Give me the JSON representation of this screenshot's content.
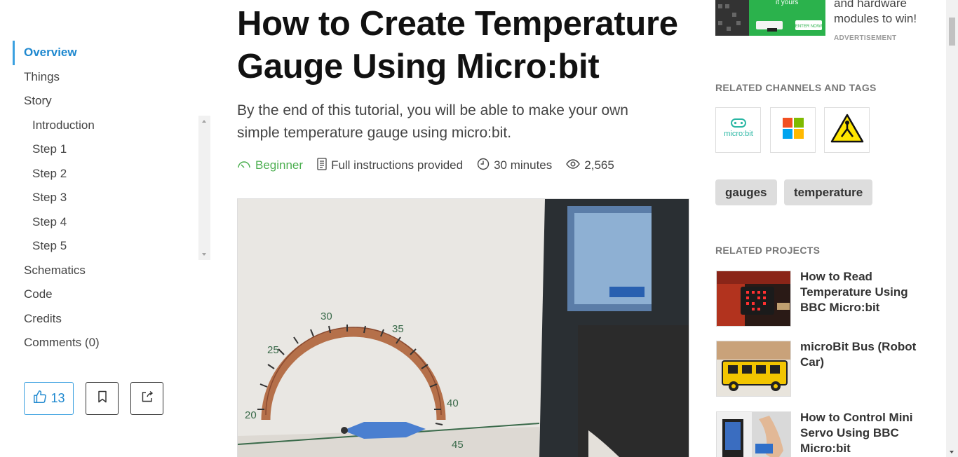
{
  "toc": {
    "items": [
      {
        "label": "Overview"
      },
      {
        "label": "Things"
      },
      {
        "label": "Story"
      }
    ],
    "sub_items": [
      {
        "label": "Introduction"
      },
      {
        "label": "Step 1"
      },
      {
        "label": "Step 2"
      },
      {
        "label": "Step 3"
      },
      {
        "label": "Step 4"
      },
      {
        "label": "Step 5"
      }
    ],
    "after_items": [
      {
        "label": "Schematics"
      },
      {
        "label": "Code"
      },
      {
        "label": "Credits"
      },
      {
        "label": "Comments (0)"
      }
    ]
  },
  "actions": {
    "like_count": "13",
    "like_icon": "thumbs-up-icon",
    "bookmark_icon": "bookmark-icon",
    "share_icon": "share-icon"
  },
  "project": {
    "title_line1": "How to Create Temperature",
    "title_line2": "Gauge Using Micro:bit",
    "subtitle_line1": "By the end of this tutorial, you will be able to make your own",
    "subtitle_line2": "simple temperature gauge using micro:bit.",
    "difficulty": "Beginner",
    "instructions": "Full instructions provided",
    "duration": "30 minutes",
    "views": "2,565"
  },
  "video": {
    "gauge_labels": [
      "20",
      "25",
      "30",
      "35",
      "40",
      "45"
    ]
  },
  "ad": {
    "text_line1": "and hardware",
    "text_line2": "modules to win!",
    "label": "ADVERTISEMENT",
    "banner_text": "it yours",
    "banner_button": "ENTER NOW!"
  },
  "related_channels": {
    "heading": "RELATED CHANNELS AND TAGS",
    "channels": [
      {
        "name": "micro:bit",
        "icon": "microbit-logo-icon"
      },
      {
        "name": "Microsoft",
        "icon": "microsoft-logo-icon"
      },
      {
        "name": "Warning",
        "icon": "warning-triangle-icon"
      }
    ],
    "tags": [
      "gauges",
      "temperature"
    ]
  },
  "related_projects": {
    "heading": "RELATED PROJECTS",
    "items": [
      {
        "title": "How to Read Temperature Using BBC Micro:bit"
      },
      {
        "title": "microBit Bus (Robot Car)"
      },
      {
        "title": "How to Control Mini Servo Using BBC Micro:bit"
      }
    ]
  },
  "colors": {
    "accent": "#1e88cf",
    "beginner_green": "#4caf50",
    "tag_bg": "#dddddd"
  }
}
